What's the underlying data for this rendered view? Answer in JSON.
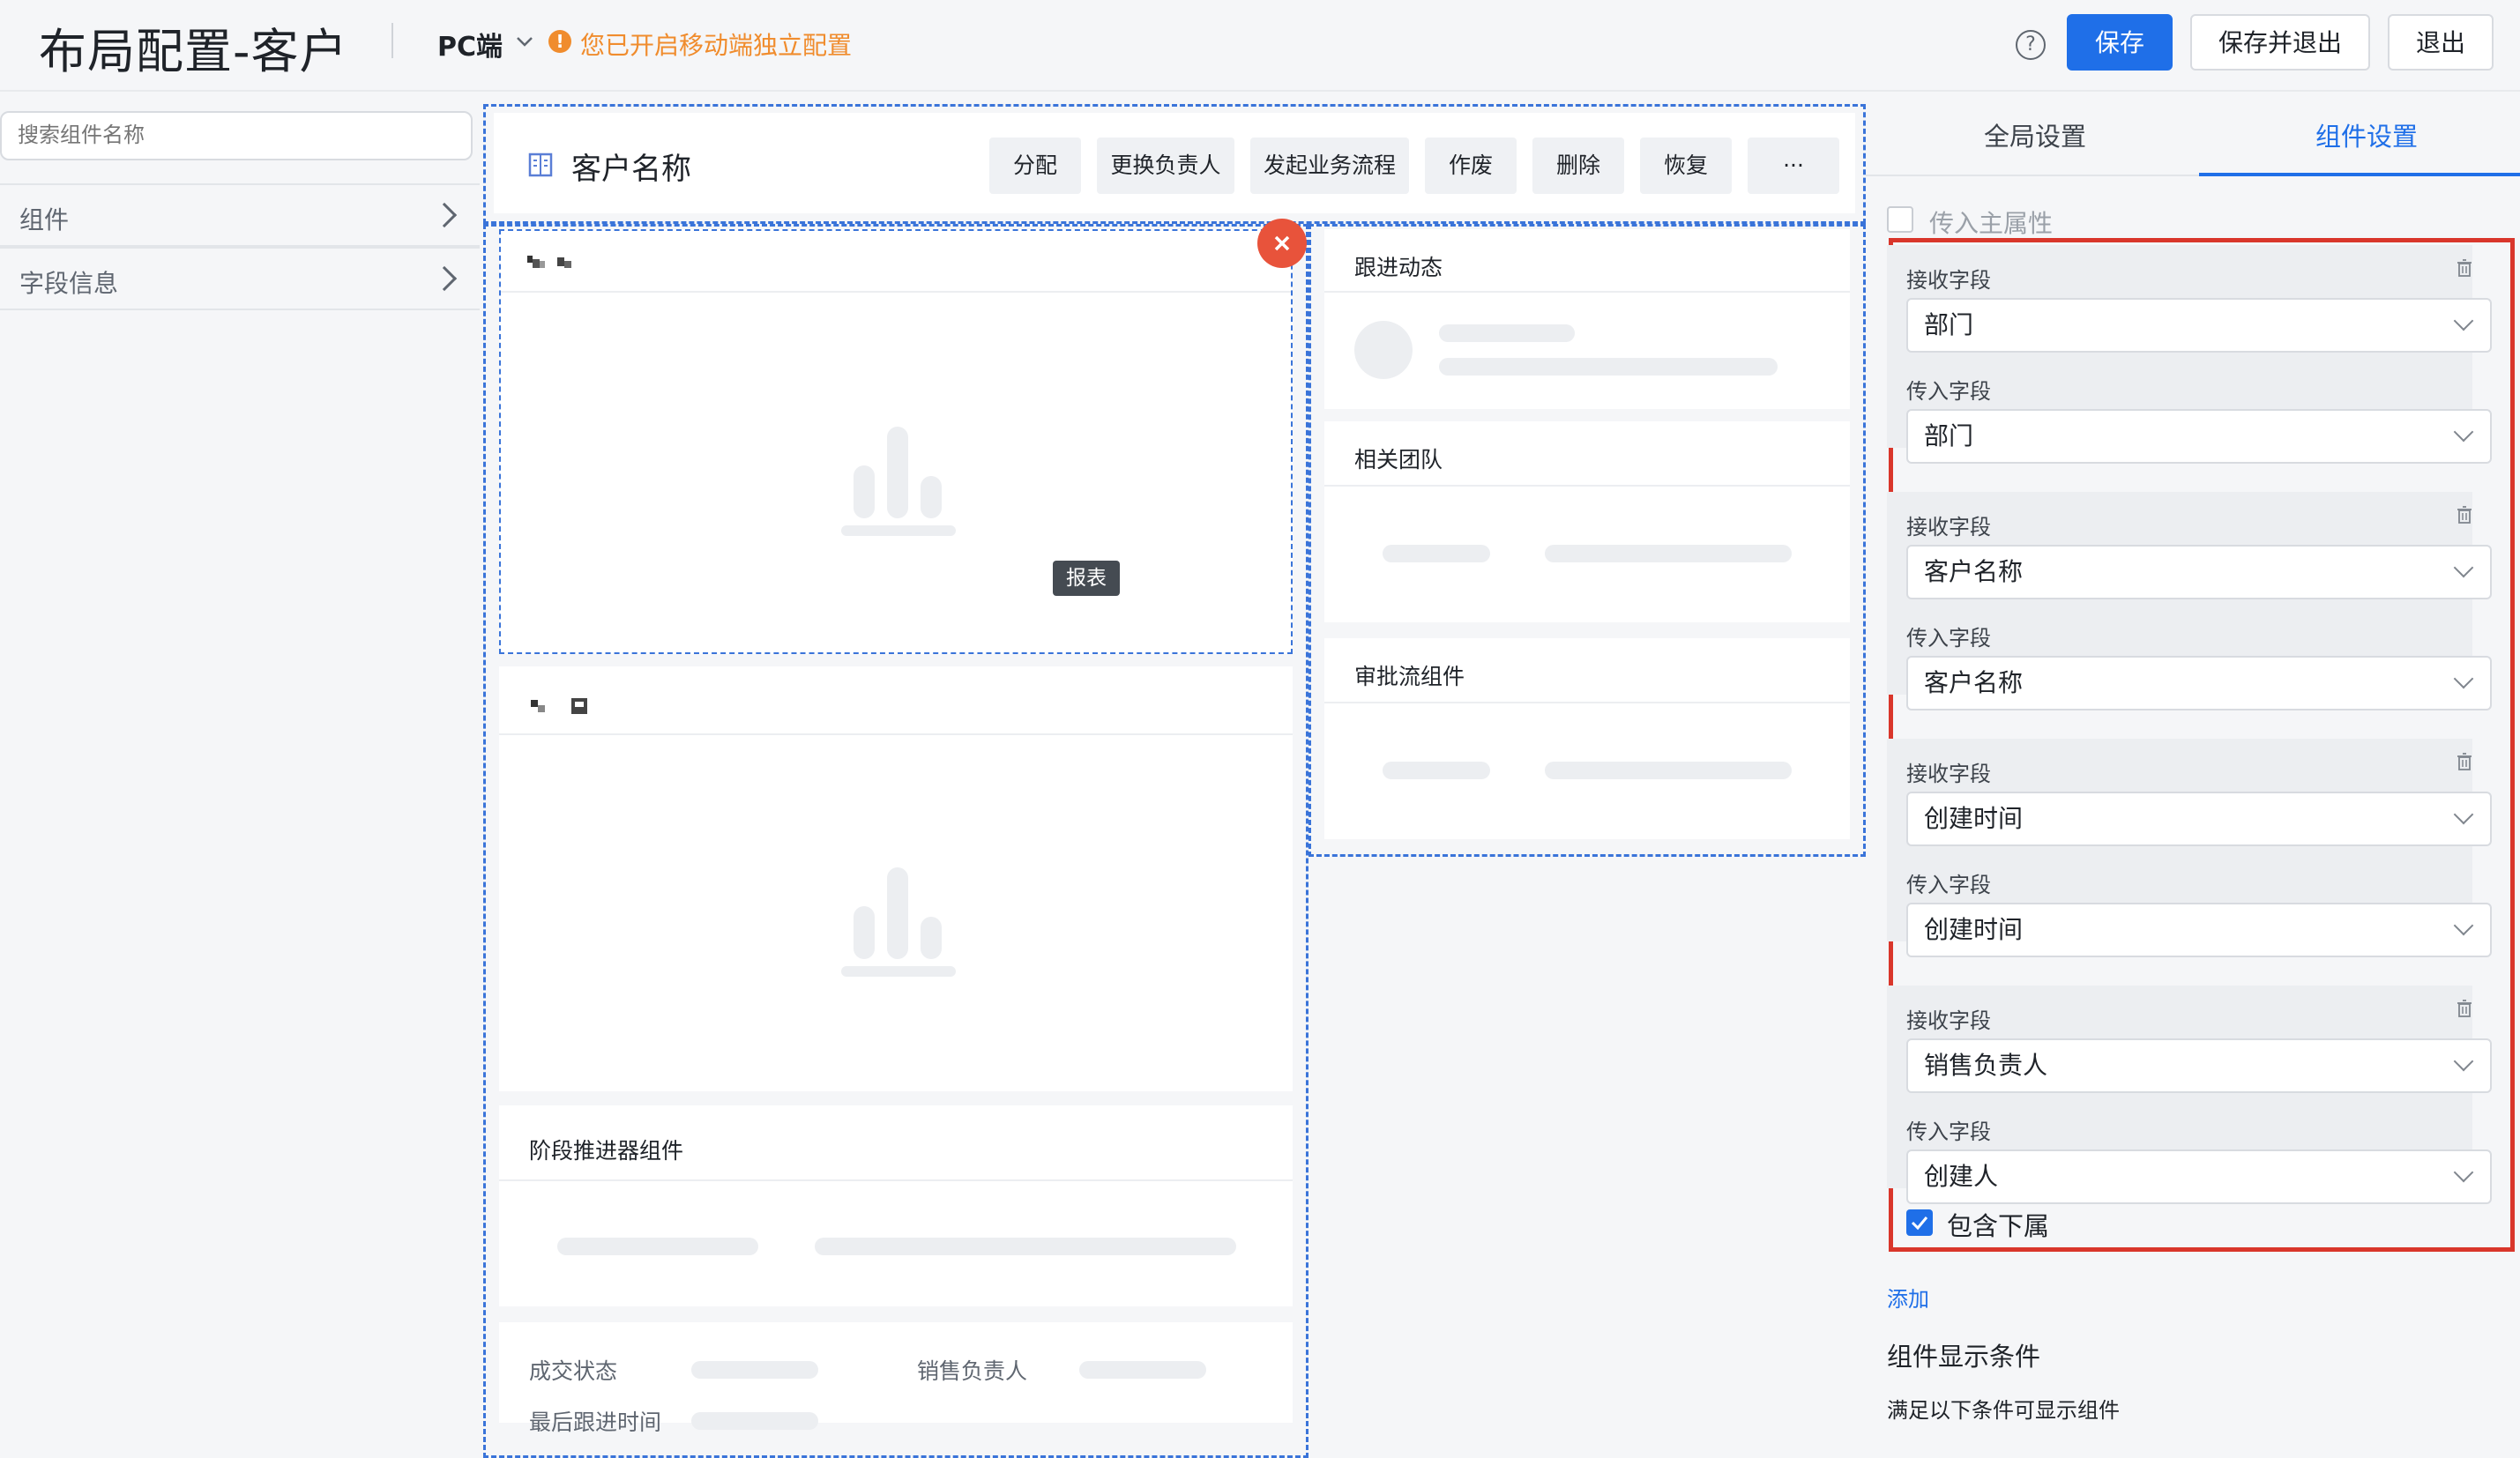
{
  "header": {
    "title": "布局配置-客户",
    "platform": "PC端",
    "warning": "您已开启移动端独立配置",
    "save": "保存",
    "save_exit": "保存并退出",
    "exit": "退出"
  },
  "left_panel": {
    "search_placeholder": "搜索组件名称",
    "items": [
      "组件",
      "字段信息"
    ]
  },
  "canvas": {
    "record_title": "客户名称",
    "actions": [
      "分配",
      "更换负责人",
      "发起业务流程",
      "作废",
      "删除",
      "恢复",
      "···"
    ],
    "tooltip": "报表",
    "cards": {
      "follow": "跟进动态",
      "team": "相关团队",
      "approval": "审批流组件",
      "stage": "阶段推进器组件",
      "deal_status": "成交状态",
      "sales_owner": "销售负责人",
      "last_follow": "最后跟进时间"
    }
  },
  "right_panel": {
    "tabs": [
      "全局设置",
      "组件设置"
    ],
    "active_tab": 1,
    "pass_main_attr": "传入主属性",
    "receive_label": "接收字段",
    "pass_label": "传入字段",
    "mappings": [
      {
        "receive": "部门",
        "pass": "部门"
      },
      {
        "receive": "客户名称",
        "pass": "客户名称"
      },
      {
        "receive": "创建时间",
        "pass": "创建时间"
      },
      {
        "receive": "销售负责人",
        "pass": "创建人"
      }
    ],
    "include_sub": "包含下属",
    "include_sub_checked": true,
    "add": "添加",
    "display_condition_title": "组件显示条件",
    "display_condition_desc": "满足以下条件可显示组件"
  },
  "colors": {
    "primary": "#1f6fe8",
    "warning": "#f08c2d",
    "highlight": "#d9362b",
    "remove": "#e8533b"
  }
}
